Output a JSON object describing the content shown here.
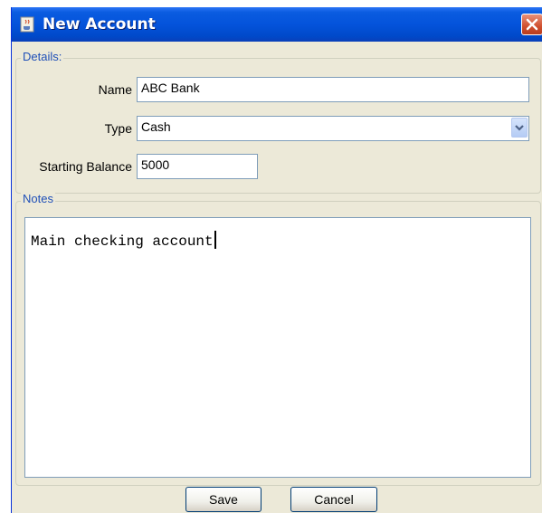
{
  "window": {
    "title": "New Account",
    "icon": "java-cup-icon",
    "close_icon": "close-icon"
  },
  "details": {
    "legend": "Details:",
    "name_label": "Name",
    "name_value": "ABC Bank",
    "type_label": "Type",
    "type_value": "Cash",
    "balance_label": "Starting Balance",
    "balance_value": "5000"
  },
  "notes": {
    "legend": "Notes",
    "value": "Main checking account"
  },
  "buttons": {
    "save_label": "Save",
    "cancel_label": "Cancel"
  },
  "colors": {
    "titlebar": "#0453db",
    "window_bg": "#ece9d8",
    "legend_text": "#2050b8",
    "close_button": "#d0502f"
  }
}
